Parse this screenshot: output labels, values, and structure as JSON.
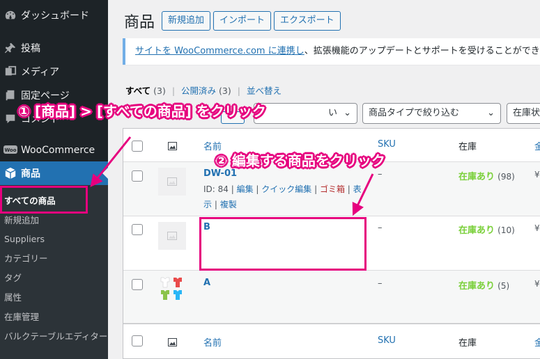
{
  "sidebar": {
    "dashboard": "ダッシュボード",
    "posts": "投稿",
    "media": "メディア",
    "pages": "固定ページ",
    "comments": "コメント",
    "woocommerce": "WooCommerce",
    "products": "商品",
    "submenu": [
      "すべての商品",
      "新規追加",
      "Suppliers",
      "カテゴリー",
      "タグ",
      "属性",
      "在庫管理",
      "バルクテーブルエディター"
    ]
  },
  "header": {
    "title": "商品",
    "buttons": [
      "新規追加",
      "インポート",
      "エクスポート"
    ]
  },
  "notice": {
    "link": "サイトを WooCommerce.com に連携し",
    "text": "、拡張機能のアップデートとサポートを受けることができます"
  },
  "filters": {
    "all": "すべて",
    "all_count": "(3)",
    "published": "公開済み",
    "published_count": "(3)",
    "sort": "並べ替え"
  },
  "toolbar": {
    "category_select_tail": "い",
    "type_select": "商品タイプで絞り込む",
    "stock_select": "在庫状"
  },
  "table": {
    "headers": {
      "name": "名前",
      "sku": "SKU",
      "stock": "在庫",
      "price": "金"
    },
    "rows": [
      {
        "name": "DW-01",
        "id": "ID: 84",
        "edit": "編集",
        "quick_edit": "クイック編集",
        "trash": "ゴミ箱",
        "view": "表示",
        "duplicate": "複製",
        "sku": "–",
        "stock": "在庫あり",
        "qty": "(98)",
        "price": "¥"
      },
      {
        "name": "B",
        "sku": "–",
        "stock": "在庫あり",
        "qty": "(10)",
        "price": "¥"
      },
      {
        "name": "A",
        "sku": "–",
        "stock": "在庫あり",
        "qty": "(5)",
        "price": "¥"
      }
    ]
  },
  "annotations": {
    "step1": "① [商品] > [すべての商品] をクリック",
    "step2": "② 編集する商品をクリック"
  },
  "colors": {
    "accent": "#2271b1",
    "highlight": "#e6007e",
    "in_stock": "#7ad03a",
    "sidebar": "#1d2327"
  }
}
